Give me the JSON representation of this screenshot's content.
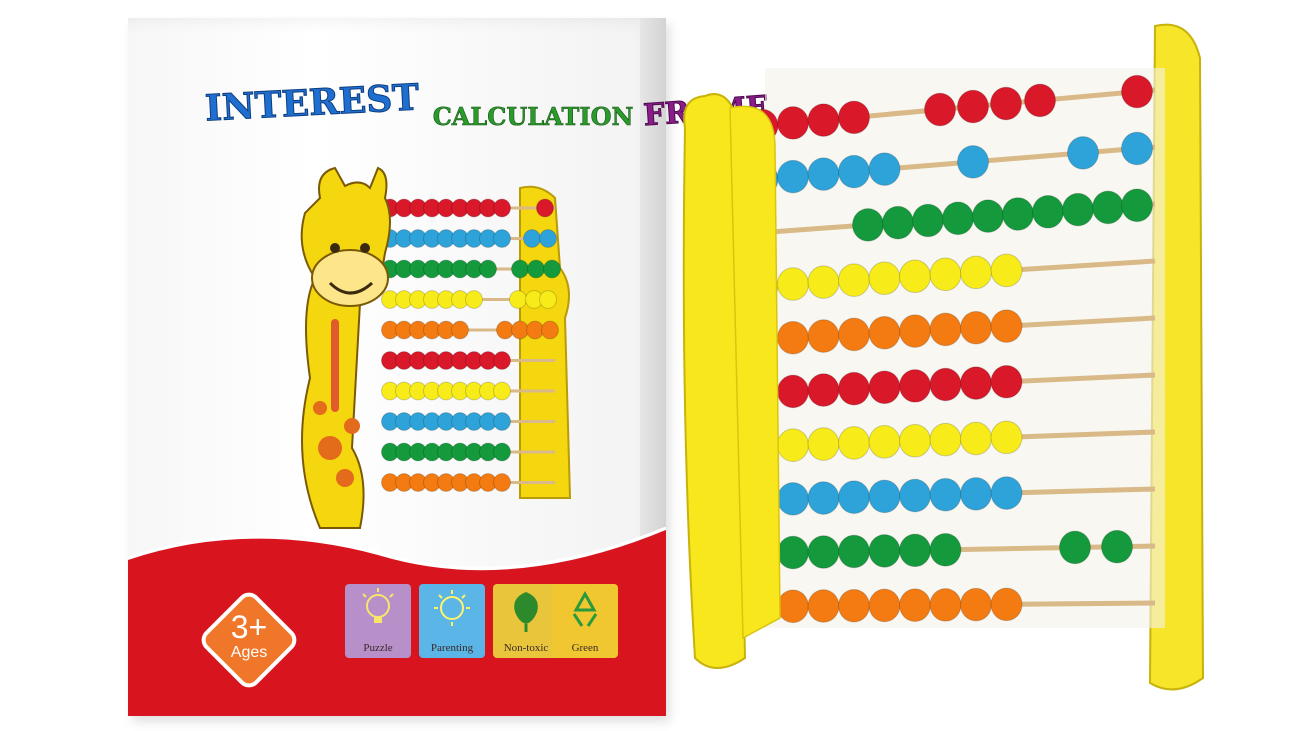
{
  "box": {
    "title_part1": "INTEREST",
    "title_part2": "CALCULATION",
    "title_part3": "FRAME",
    "age_number": "3+",
    "age_label": "Ages",
    "features": [
      {
        "label": "Puzzle",
        "icon": "lightbulb-icon",
        "color": "#b78fc9"
      },
      {
        "label": "Parenting",
        "icon": "sun-icon",
        "color": "#5bb5e6"
      },
      {
        "label": "Non-toxic",
        "icon": "leaf-icon",
        "color": "#e8c53a"
      },
      {
        "label": "Green",
        "icon": "recycle-icon",
        "color": "#f0c730"
      }
    ]
  },
  "colors": {
    "red": "#d9182a",
    "blue": "#2ea3d9",
    "green": "#149a3c",
    "yellow": "#f7ec1a",
    "orange": "#f47b12",
    "frame_yellow": "#f8e71c"
  }
}
